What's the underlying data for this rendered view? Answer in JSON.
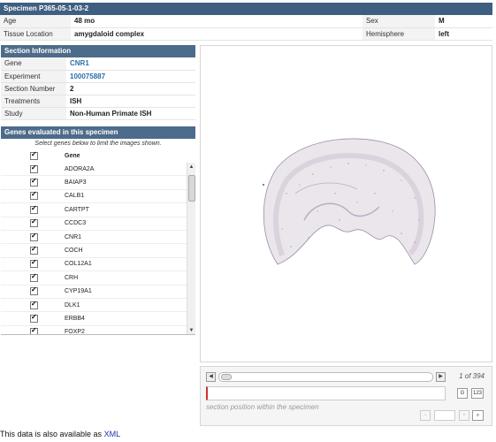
{
  "specimen": {
    "title": "Specimen P365-05-1-03-2",
    "age_label": "Age",
    "age_value": "48 mo",
    "sex_label": "Sex",
    "sex_value": "M",
    "tissue_label": "Tissue Location",
    "tissue_value": "amygdaloid complex",
    "hemisphere_label": "Hemisphere",
    "hemisphere_value": "left"
  },
  "section": {
    "title": "Section Information",
    "rows": [
      {
        "label": "Gene",
        "value": "CNR1"
      },
      {
        "label": "Experiment",
        "value": "100075887"
      },
      {
        "label": "Section Number",
        "value": "2"
      },
      {
        "label": "Treatments",
        "value": "ISH"
      },
      {
        "label": "Study",
        "value": "Non-Human Primate ISH"
      }
    ]
  },
  "genes": {
    "title": "Genes evaluated in this specimen",
    "hint": "Select genes below to limit the images shown.",
    "column_header": "Gene",
    "list": [
      "ADORA2A",
      "BAIAP3",
      "CALB1",
      "CARTPT",
      "CCDC3",
      "CNR1",
      "COCH",
      "COL12A1",
      "CRH",
      "CYP19A1",
      "DLK1",
      "ERBB4",
      "FOXP2"
    ]
  },
  "viewer": {
    "position_text": "1 of 394",
    "position_note": "section position within the specimen",
    "icons": [
      "chevron-left-icon",
      "chevron-right-icon",
      "zoom-out-icon",
      "zoom-in-icon",
      "search-icon"
    ]
  },
  "footer": {
    "text": "This data is also available as",
    "link": "XML"
  },
  "colors": {
    "header_bg": "#4d6b8a",
    "link": "#2a6fa8"
  }
}
